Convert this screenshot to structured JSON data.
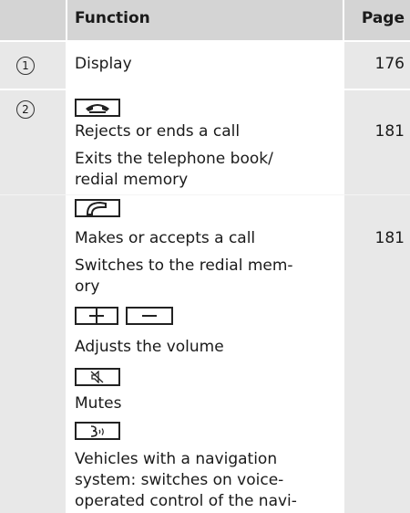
{
  "header": {
    "function": "Function",
    "page": "Page"
  },
  "rows": [
    {
      "num": "1",
      "label": "Display",
      "page": "176"
    },
    {
      "num": "2"
    }
  ],
  "items": {
    "reject_text": "Rejects or ends a call",
    "reject_page": "181",
    "exit_line1": "Exits the telephone book/",
    "exit_line2": "redial memory",
    "accept_text": "Makes or accepts a call",
    "accept_page": "181",
    "switch_line1": "Switches to the redial mem-",
    "switch_line2": "ory",
    "volume_text": "Adjusts the volume",
    "mute_text": "Mutes",
    "voice_line1": "Vehicles with a navigation",
    "voice_line2": "system: switches on voice-",
    "voice_line3": "operated control of the navi-"
  },
  "icons": {
    "end_call": "end-call-icon",
    "accept_call": "accept-call-icon",
    "plus": "plus-icon",
    "minus": "minus-icon",
    "mute": "mute-icon",
    "voice": "voice-control-icon"
  }
}
